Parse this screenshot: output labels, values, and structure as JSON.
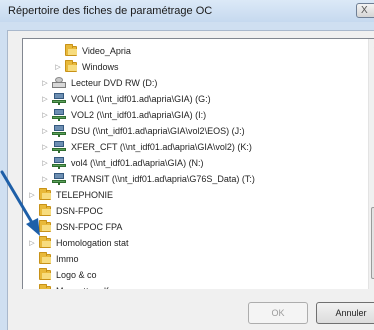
{
  "window": {
    "title": "Répertoire des fiches de paramétrage OC",
    "close_glyph": "X"
  },
  "tree": {
    "items": [
      {
        "label": "Video_Apria",
        "icon": "folder-icon",
        "expander": ""
      },
      {
        "label": "Windows",
        "icon": "folder-icon",
        "expander": "▷"
      },
      {
        "label": "Lecteur DVD RW (D:)",
        "icon": "dvd-drive-icon",
        "expander": "▷"
      },
      {
        "label": "VOL1 (\\\\nt_idf01.ad\\apria\\GIA) (G:)",
        "icon": "network-drive-icon",
        "expander": "▷"
      },
      {
        "label": "VOL2 (\\\\nt_idf01.ad\\apria\\GIA) (I:)",
        "icon": "network-drive-icon",
        "expander": "▷"
      },
      {
        "label": "DSU (\\\\nt_idf01.ad\\apria\\GIA\\vol2\\EOS) (J:)",
        "icon": "network-drive-icon",
        "expander": "▷"
      },
      {
        "label": "XFER_CFT (\\\\nt_idf01.ad\\apria\\GIA\\vol2) (K:)",
        "icon": "network-drive-icon",
        "expander": "▷"
      },
      {
        "label": "vol4 (\\\\nt_idf01.ad\\apria\\GIA) (N:)",
        "icon": "network-drive-icon",
        "expander": "▷"
      },
      {
        "label": "TRANSIT (\\\\nt_idf01.ad\\apria\\G76S_Data) (T:)",
        "icon": "network-drive-icon",
        "expander": "▷"
      },
      {
        "label": "TELEPHONIE",
        "icon": "folder-icon",
        "expander": "▷"
      },
      {
        "label": "DSN-FPOC",
        "icon": "folder-icon",
        "expander": ""
      },
      {
        "label": "DSN-FPOC FPA",
        "icon": "folder-icon",
        "expander": ""
      },
      {
        "label": "Homologation stat",
        "icon": "folder-icon",
        "expander": "▷"
      },
      {
        "label": "Immo",
        "icon": "folder-icon",
        "expander": ""
      },
      {
        "label": "Logo & co",
        "icon": "folder-icon",
        "expander": ""
      },
      {
        "label": "Maquette pdf",
        "icon": "folder-icon",
        "expander": ""
      }
    ]
  },
  "scrollbar": {
    "up_glyph": "▲",
    "down_glyph": "▼",
    "grip": "≡"
  },
  "buttons": {
    "ok_label": "OK",
    "cancel_label": "Annuler"
  },
  "colors": {
    "arrow": "#1e5fa8",
    "folder": "#e8b93a"
  }
}
